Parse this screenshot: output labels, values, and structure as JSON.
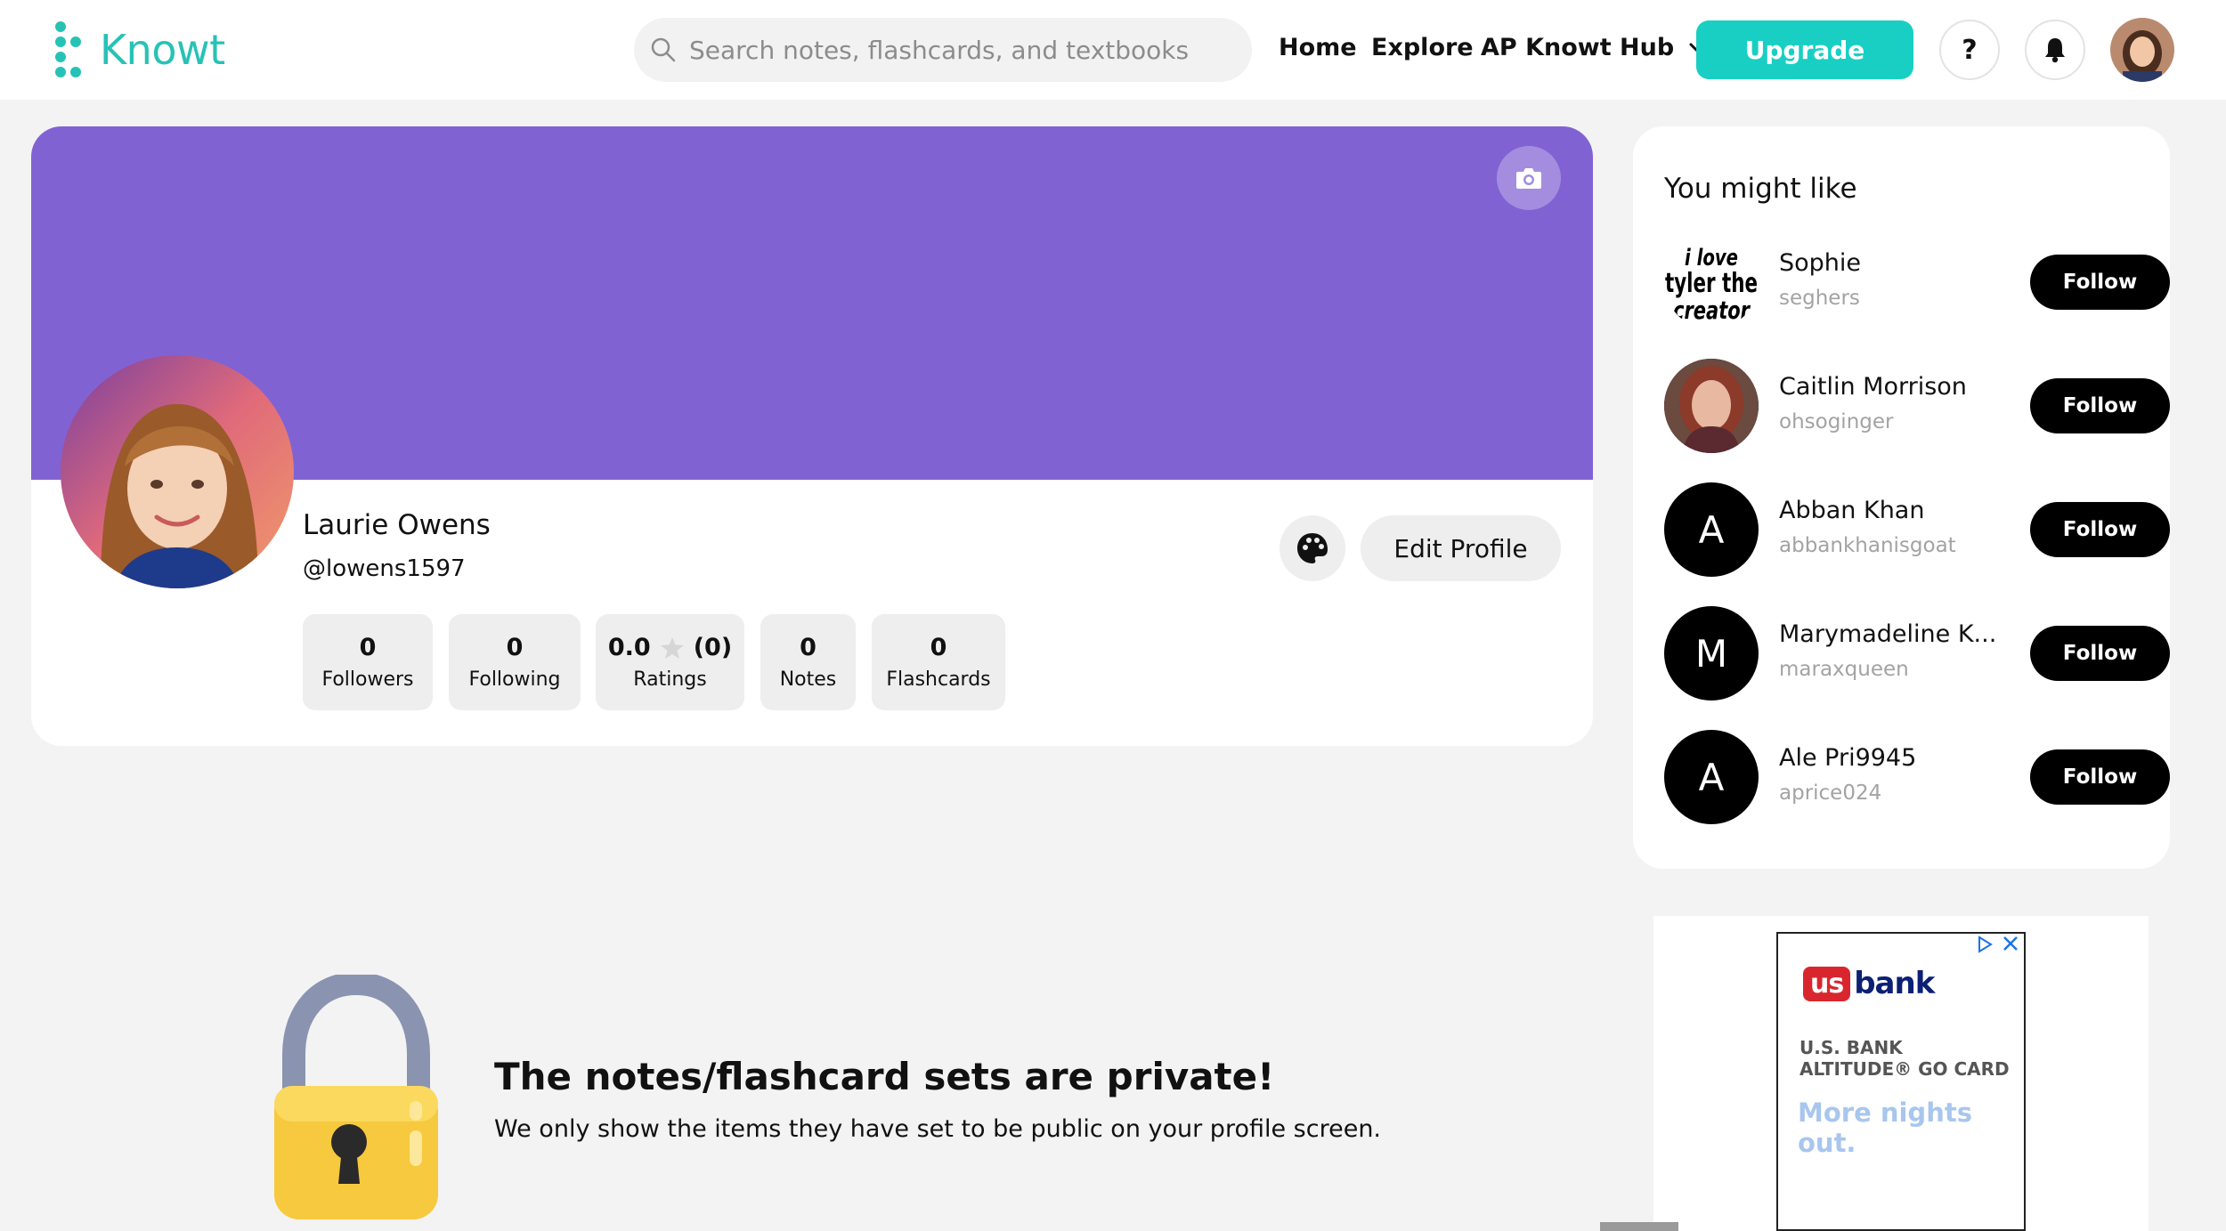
{
  "header": {
    "logo_text": "Knowt",
    "search_placeholder": "Search notes, flashcards, and textbooks",
    "nav": [
      "Home",
      "Explore",
      "AP Knowt Hub"
    ],
    "upgrade_label": "Upgrade",
    "help_label": "?"
  },
  "profile": {
    "name": "Laurie Owens",
    "handle": "@lowens1597",
    "cover_color": "#8162d3",
    "edit_label": "Edit Profile",
    "stats": {
      "followers": {
        "value": "0",
        "label": "Followers"
      },
      "following": {
        "value": "0",
        "label": "Following"
      },
      "ratings": {
        "value": "0.0",
        "count": "(0)",
        "label": "Ratings"
      },
      "notes": {
        "value": "0",
        "label": "Notes"
      },
      "flashcards": {
        "value": "0",
        "label": "Flashcards"
      }
    }
  },
  "suggestions": {
    "title": "You might like",
    "follow_label": "Follow",
    "items": [
      {
        "name": "Sophie",
        "username": "seghers",
        "avatar_text": "i love tyler the creator"
      },
      {
        "name": "Caitlin Morrison",
        "username": "ohsoginger"
      },
      {
        "name": "Abban Khan",
        "username": "abbankhanisgoat",
        "initial": "A"
      },
      {
        "name": "Marymadeline K...",
        "username": "maraxqueen",
        "initial": "M"
      },
      {
        "name": "Ale Pri9945",
        "username": "aprice024",
        "initial": "A"
      }
    ]
  },
  "ad": {
    "brand_us": "us",
    "brand_bank": "bank",
    "line1": "U.S. BANK",
    "line2": "ALTITUDE® GO CARD",
    "tagline": "More nights out."
  },
  "private_notice": {
    "title": "The notes/flashcard sets are private!",
    "subtitle": "We only show the items they have set to be public on your profile screen."
  },
  "colors": {
    "accent": "#19cfc4",
    "cover": "#8162d3"
  }
}
